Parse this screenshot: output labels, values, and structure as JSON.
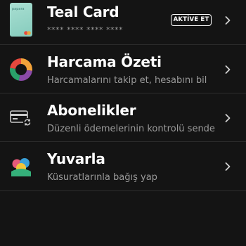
{
  "items": [
    {
      "title": "Teal Card",
      "subtitle": "**** **** **** ****",
      "badge": "AKTİVE ET",
      "icon": "teal-card-icon",
      "card_brand": "papara"
    },
    {
      "title": "Harcama Özeti",
      "subtitle": "Harcamalarını takip et, hesabını bil",
      "icon": "spending-summary-donut-icon"
    },
    {
      "title": "Abonelikler",
      "subtitle": "Düzenli ödemelerinin kontrolü sende",
      "icon": "subscription-card-refresh-icon"
    },
    {
      "title": "Yuvarla",
      "subtitle": "Küsuratlarınla bağış yap",
      "icon": "round-up-donation-icon"
    }
  ],
  "colors": {
    "background": "#141414",
    "divider": "#2c2c2c",
    "subtitle": "#9a9a9a",
    "teal_card": "#a9dfd2"
  }
}
